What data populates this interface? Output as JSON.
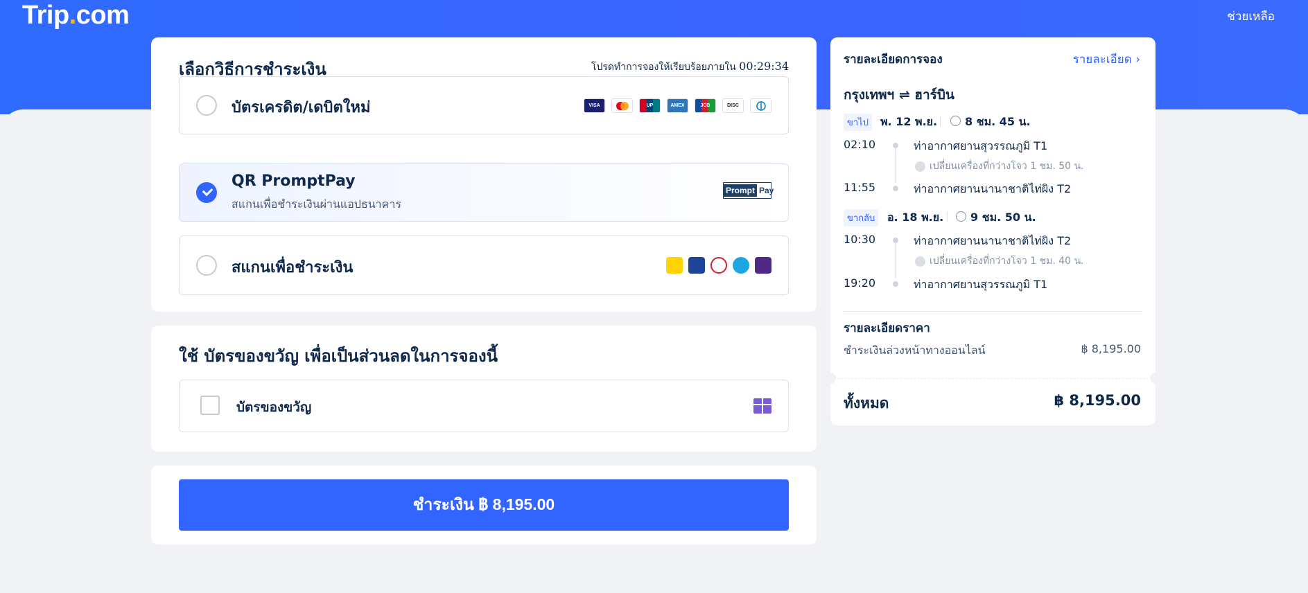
{
  "header": {
    "logo_main": "Trip",
    "logo_dot": ".",
    "logo_tail": "com",
    "help": "ช่วยเหลือ"
  },
  "payment": {
    "title": "เลือกวิธีการชำระเงิน",
    "timer_label": "โปรดทำการจองให้เรียบร้อยภายใน",
    "timer_value": "00:29:34",
    "options": [
      {
        "label": "บัตรเครดิต/เดบิตใหม่",
        "selected": false,
        "icons": [
          "visa-icon",
          "mastercard-icon",
          "unionpay-icon",
          "amex-icon",
          "jcb-icon",
          "discover-icon",
          "diners-icon"
        ]
      },
      {
        "label": "QR PromptPay",
        "sub": "สแกนเพื่อชำระเงินผ่านแอปธนาคาร",
        "selected": true,
        "logo_a": "Prompt",
        "logo_b": "Pay"
      },
      {
        "label": "สแกนเพื่อชำระเงิน",
        "selected": false,
        "icons": [
          "krungsri-icon",
          "bangkok-bank-icon",
          "kasikorn-icon",
          "krungthai-icon",
          "scb-icon"
        ]
      }
    ]
  },
  "gift": {
    "title": "ใช้ บัตรของขวัญ เพื่อเป็นส่วนลดในการจองนี้",
    "checkbox_label": "บัตรของขวัญ",
    "icon": "gift-icon"
  },
  "pay_button": {
    "label": "ชำระเงิน ฿ 8,195.00"
  },
  "booking": {
    "title": "รายละเอียดการจอง",
    "details_link": "รายละเอียด",
    "route": "กรุงเทพฯ ⇌ ฮาร์บิน",
    "outbound": {
      "tag": "ขาไป",
      "date": "พ. 12 พ.ย.",
      "duration": "8 ชม. 45 น.",
      "dep_time": "02:10",
      "dep_airport": "ท่าอากาศยานสุวรรณภูมิ T1",
      "transfer": "เปลี่ยนเครื่องที่กว่างโจว 1 ชม. 50 น.",
      "arr_time": "11:55",
      "arr_airport": "ท่าอากาศยานนานาชาติไท่ผิง T2"
    },
    "inbound": {
      "tag": "ขากลับ",
      "date": "อ. 18 พ.ย.",
      "duration": "9 ชม. 50 น.",
      "dep_time": "10:30",
      "dep_airport": "ท่าอากาศยานนานาชาติไท่ผิง T2",
      "transfer": "เปลี่ยนเครื่องที่กว่างโจว 1 ชม. 40 น.",
      "arr_time": "19:20",
      "arr_airport": "ท่าอากาศยานสุวรรณภูมิ T1"
    },
    "price_title": "รายละเอียดราคา",
    "price_label": "ชำระเงินล่วงหน้าทางออนไลน์",
    "price_value": "฿ 8,195.00",
    "total_label": "ทั้งหมด",
    "total_value": "฿ 8,195.00"
  },
  "colors": {
    "primary": "#3264ff",
    "text": "#0f294d",
    "logo_dot": "#ffb400"
  }
}
